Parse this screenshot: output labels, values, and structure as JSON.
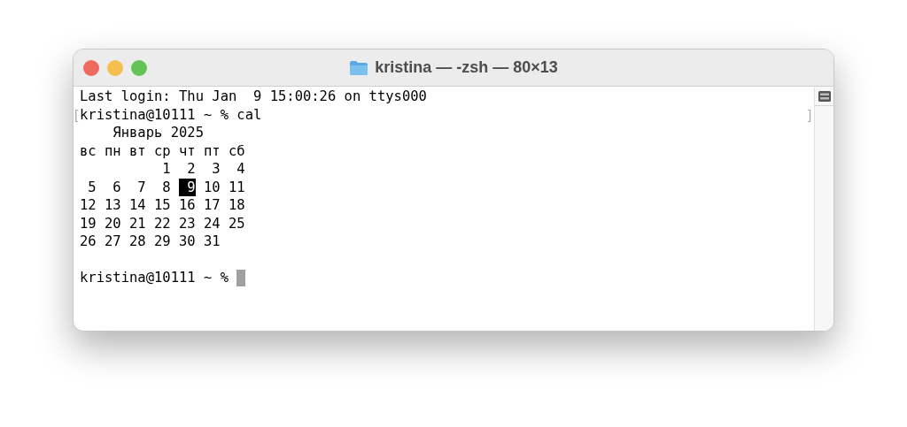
{
  "window": {
    "title": "kristina — -zsh — 80×13"
  },
  "terminal": {
    "lines": [
      {
        "segments": [
          {
            "text": "Last login: Thu Jan  9 15:00:26 on ttys000",
            "kind": "normal"
          }
        ]
      },
      {
        "left_mark": "[",
        "right_mark": "]",
        "segments": [
          {
            "text": "kristina@10111 ~ % cal",
            "kind": "normal"
          }
        ]
      },
      {
        "segments": [
          {
            "text": "    Январь 2025",
            "kind": "normal"
          }
        ]
      },
      {
        "segments": [
          {
            "text": "вс пн вт ср чт пт сб",
            "kind": "normal"
          }
        ]
      },
      {
        "segments": [
          {
            "text": "          1  2  3  4",
            "kind": "normal"
          }
        ]
      },
      {
        "segments": [
          {
            "text": " 5  6  7  8 ",
            "kind": "normal"
          },
          {
            "text": " 9",
            "kind": "highlight"
          },
          {
            "text": " 10 11",
            "kind": "normal"
          }
        ]
      },
      {
        "segments": [
          {
            "text": "12 13 14 15 16 17 18",
            "kind": "normal"
          }
        ]
      },
      {
        "segments": [
          {
            "text": "19 20 21 22 23 24 25",
            "kind": "normal"
          }
        ]
      },
      {
        "segments": [
          {
            "text": "26 27 28 29 30 31",
            "kind": "normal"
          }
        ]
      },
      {
        "blank_line_before": true,
        "segments": [
          {
            "text": "kristina@10111 ~ % ",
            "kind": "normal"
          }
        ],
        "cursor": true
      }
    ]
  }
}
